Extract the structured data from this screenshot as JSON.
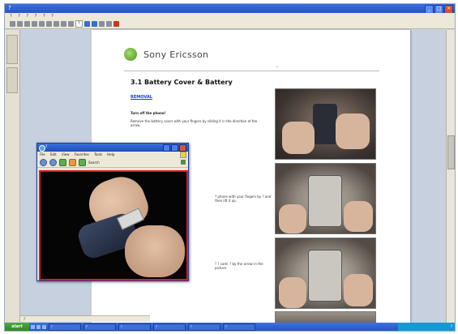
{
  "window": {
    "title": "?",
    "menu": [
      "?",
      "?",
      "?",
      "?",
      "?",
      "?"
    ],
    "zoom": "?",
    "status_page": "?"
  },
  "document": {
    "brand": "Sony Ericsson",
    "doc_ref": "?",
    "section_heading": "3.1 Battery Cover & Battery",
    "removal_link": "REMOVAL",
    "step1_title": "Turn off the phone!",
    "step1_text": "Remove the battery cover with your fingers by sliding it in the direction of the arrow.",
    "step2_text": "? phone with your fingers by ? and then lift it up.",
    "step3_text": "? ? card. ? by the arrow in the picture."
  },
  "browser_popup": {
    "title": "?",
    "menu": [
      "File",
      "Edit",
      "View",
      "Favorites",
      "Tools",
      "Help"
    ],
    "search_label": "Search"
  },
  "taskbar": {
    "start_label": "start",
    "tasks": [
      "?",
      "?",
      "?",
      "?",
      "?",
      "?"
    ],
    "clock": "?"
  },
  "colors": {
    "titlebar": "#2656c0",
    "video_border": "#e01b1b",
    "link": "#1a3fbf",
    "start_button": "#2f8a25"
  },
  "icons": [
    "close-icon",
    "minimize-icon",
    "maximize-icon",
    "internet-explorer-icon",
    "back-icon",
    "forward-icon",
    "refresh-icon",
    "search-icon",
    "windows-flag-icon"
  ]
}
